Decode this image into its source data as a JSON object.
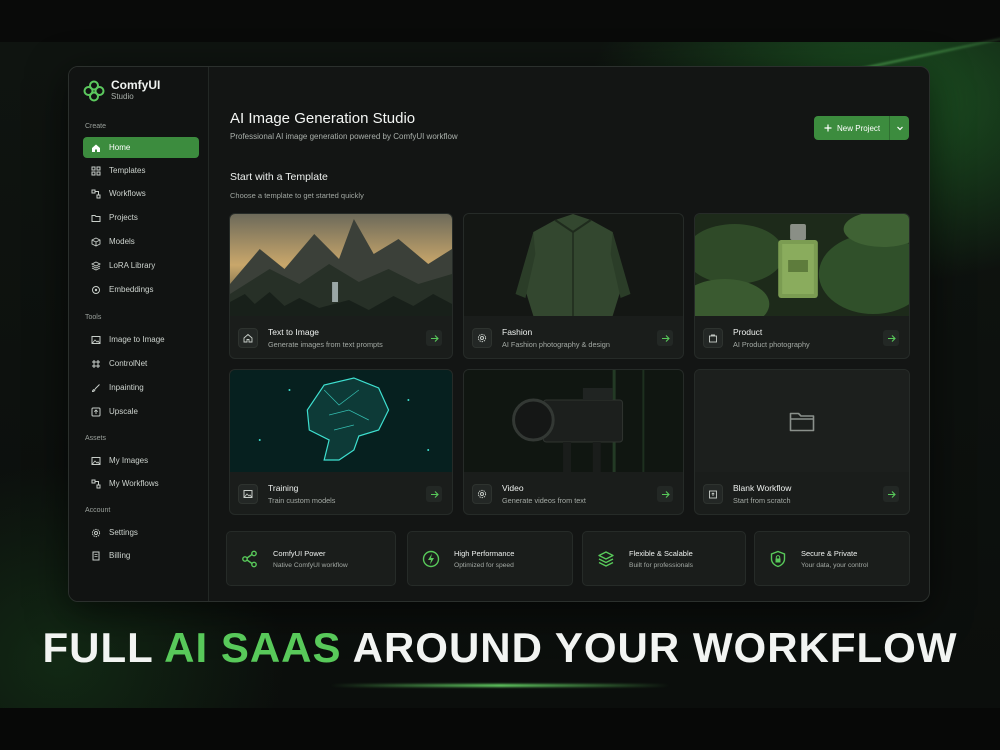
{
  "brand": {
    "name": "ComfyUI",
    "sub": "Studio"
  },
  "sidebar": {
    "sections": [
      {
        "label": "Create",
        "items": [
          {
            "label": "Home",
            "icon": "home-icon",
            "active": true
          },
          {
            "label": "Templates",
            "icon": "grid-icon"
          },
          {
            "label": "Workflows",
            "icon": "workflow-icon"
          },
          {
            "label": "Projects",
            "icon": "folder-icon"
          },
          {
            "label": "Models",
            "icon": "cube-icon"
          },
          {
            "label": "LoRA Library",
            "icon": "layers-icon"
          },
          {
            "label": "Embeddings",
            "icon": "embedding-icon"
          }
        ]
      },
      {
        "label": "Tools",
        "items": [
          {
            "label": "Image to Image",
            "icon": "image-icon"
          },
          {
            "label": "ControlNet",
            "icon": "controlnet-icon"
          },
          {
            "label": "Inpainting",
            "icon": "brush-icon"
          },
          {
            "label": "Upscale",
            "icon": "upscale-icon"
          }
        ]
      },
      {
        "label": "Assets",
        "items": [
          {
            "label": "My Images",
            "icon": "image-icon"
          },
          {
            "label": "My Workflows",
            "icon": "workflow-icon"
          }
        ]
      },
      {
        "label": "Account",
        "items": [
          {
            "label": "Settings",
            "icon": "gear-icon"
          },
          {
            "label": "Billing",
            "icon": "billing-icon"
          }
        ]
      }
    ]
  },
  "header": {
    "title": "AI Image Generation Studio",
    "subtitle": "Professional AI image generation powered by ComfyUI workflow",
    "new_project": "New Project"
  },
  "templates": {
    "title": "Start with a Template",
    "subtitle": "Choose a template to get started quickly",
    "cards": [
      {
        "title": "Text to Image",
        "subtitle": "Generate images from text prompts",
        "icon": "home-icon",
        "thumb": "mountain-landscape-thumbnail"
      },
      {
        "title": "Fashion",
        "subtitle": "AI Fashion photography & design",
        "icon": "gear-icon",
        "thumb": "green-jacket-thumbnail"
      },
      {
        "title": "Product",
        "subtitle": "AI Product photography",
        "icon": "bag-icon",
        "thumb": "perfume-bottle-thumbnail"
      },
      {
        "title": "Training",
        "subtitle": "Train custom models",
        "icon": "image-icon",
        "thumb": "digital-brain-thumbnail"
      },
      {
        "title": "Video",
        "subtitle": "Generate videos from text",
        "icon": "gear-icon",
        "thumb": "cinema-camera-thumbnail"
      },
      {
        "title": "Blank Workflow",
        "subtitle": "Start from scratch",
        "icon": "upload-icon",
        "thumb": "folder-icon"
      }
    ]
  },
  "features": [
    {
      "title": "ComfyUI Power",
      "subtitle": "Native ComfyUI workflow",
      "icon": "share-nodes-icon"
    },
    {
      "title": "High Performance",
      "subtitle": "Optimized for speed",
      "icon": "bolt-icon"
    },
    {
      "title": "Flexible & Scalable",
      "subtitle": "Built for professionals",
      "icon": "stack-icon"
    },
    {
      "title": "Secure & Private",
      "subtitle": "Your data, your control",
      "icon": "shield-lock-icon"
    }
  ],
  "headline": {
    "part1": "FULL ",
    "accent": "AI SAAS",
    "part2": " AROUND YOUR WORKFLOW"
  },
  "colors": {
    "accent": "#3c8c3e",
    "accent_bright": "#58c95a",
    "background": "#0b0d0c",
    "panel": "#131514"
  }
}
